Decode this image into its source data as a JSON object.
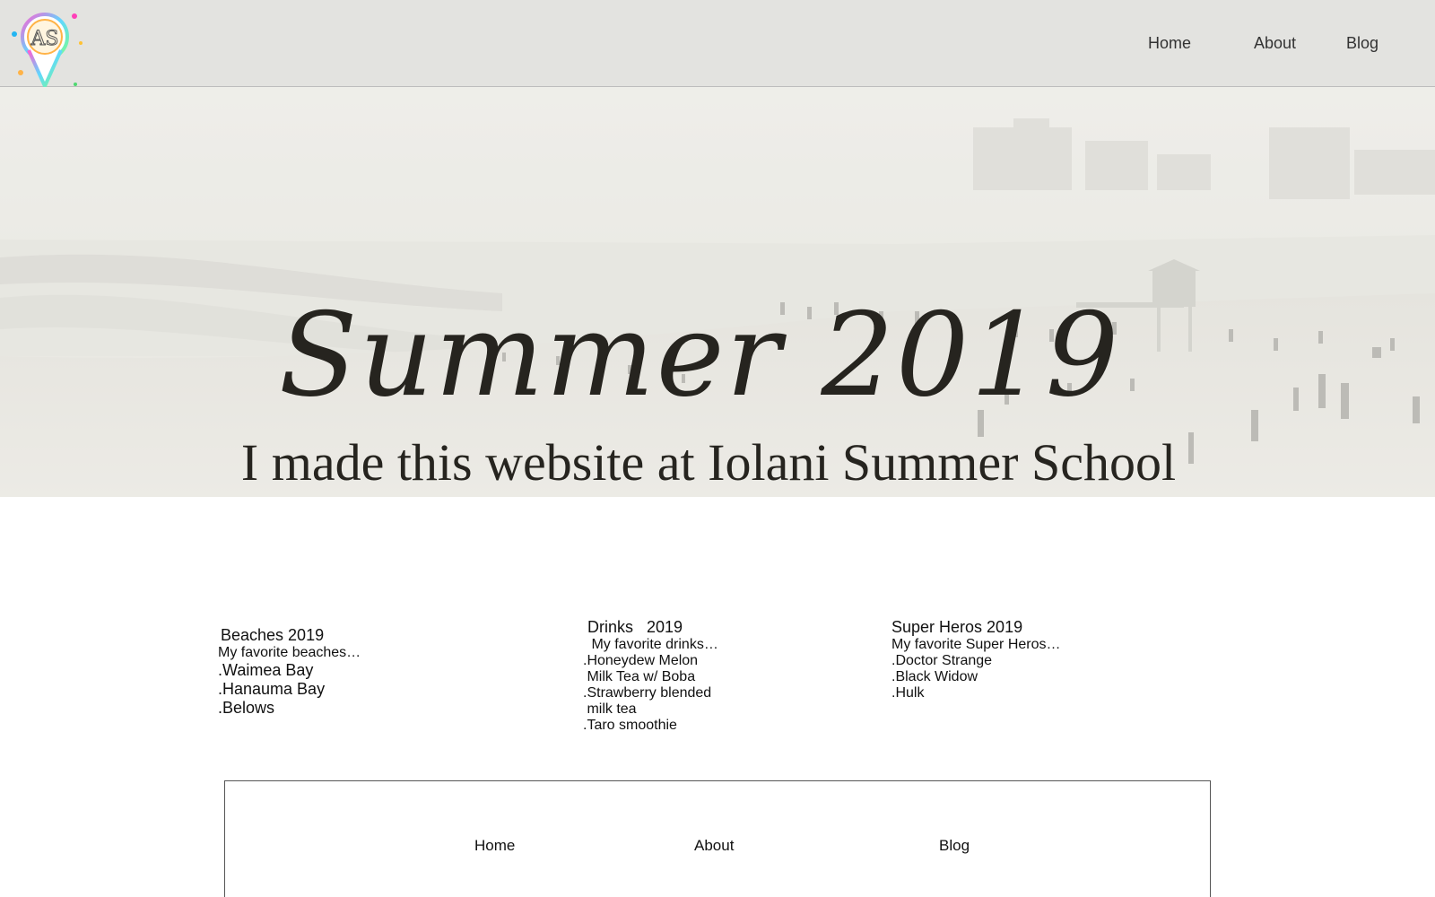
{
  "header": {
    "logo_text": "AS",
    "nav": [
      "Home",
      "About",
      "Blog"
    ]
  },
  "hero": {
    "title": "Summer 2019",
    "subtitle": "I made this website at Iolani Summer School"
  },
  "columns": {
    "beaches": {
      "title": "Beaches 2019",
      "intro": "My favorite beaches…",
      "items": [
        ".Waimea Bay",
        ".Hanauma Bay",
        ".Belows"
      ]
    },
    "drinks": {
      "title": "Drinks   2019",
      "intro": " My favorite drinks…",
      "items": [
        ".Honeydew Melon",
        " Milk Tea w/ Boba",
        ".Strawberry blended",
        " milk tea",
        ".Taro smoothie"
      ]
    },
    "super_heros": {
      "title": "Super Heros 2019",
      "intro": "My favorite Super Heros…",
      "items": [
        ".Doctor Strange",
        ".Black Widow",
        ".Hulk"
      ]
    }
  },
  "footer": {
    "nav": [
      "Home",
      "About",
      "Blog"
    ]
  }
}
